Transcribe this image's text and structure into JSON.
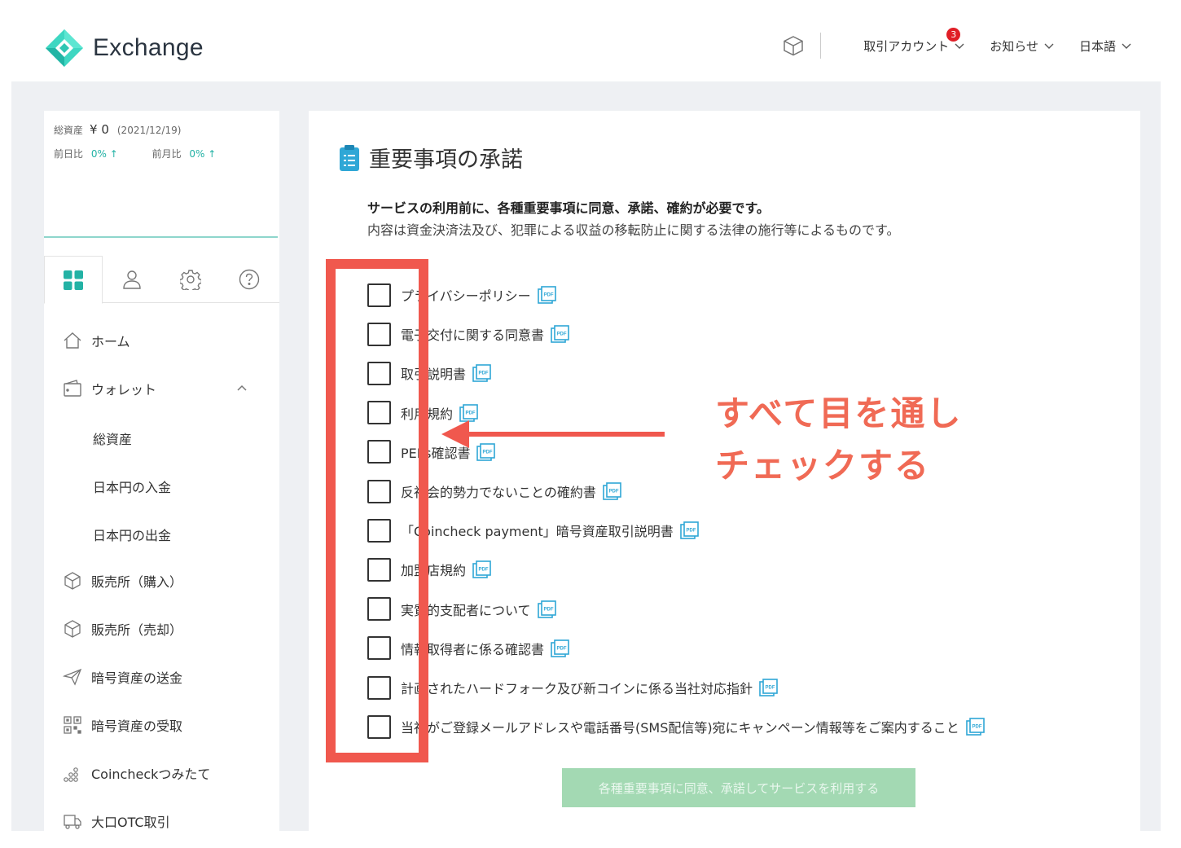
{
  "header": {
    "brand": "Exchange",
    "menu": [
      {
        "label": "取引アカウント",
        "badge": "3"
      },
      {
        "label": "お知らせ"
      },
      {
        "label": "日本語"
      }
    ]
  },
  "sidebar": {
    "assets_label": "総資産",
    "assets_value": "¥ 0",
    "assets_date": "(2021/12/19)",
    "day_label": "前日比",
    "day_value": "0% ↑",
    "month_label": "前月比",
    "month_value": "0% ↑",
    "tabs": [
      "dashboard-icon",
      "user-icon",
      "gear-icon",
      "help-icon"
    ],
    "nav": {
      "home": "ホーム",
      "wallet": "ウォレット",
      "wallet_sub": [
        "総資産",
        "日本円の入金",
        "日本円の出金"
      ],
      "buy": "販売所（購入）",
      "sell": "販売所（売却）",
      "send": "暗号資産の送金",
      "receive": "暗号資産の受取",
      "tsumitate": "Coincheckつみたて",
      "otc": "大口OTC取引"
    }
  },
  "main": {
    "title": "重要事項の承諾",
    "notice_bold": "サービスの利用前に、各種重要事項に同意、承諾、確約が必要です。",
    "notice_sub": "内容は資金決済法及び、犯罪による収益の移転防止に関する法律の施行等によるものです。",
    "items": [
      "プライバシーポリシー",
      "電子交付に関する同意書",
      "取引説明書",
      "利用規約",
      "PEPs確認書",
      "反社会的勢力でないことの確約書",
      "「Coincheck payment」暗号資産取引説明書",
      "加盟店規約",
      "実質的支配者について",
      "情報取得者に係る確認書",
      "計画されたハードフォーク及び新コインに係る当社対応指針",
      "当社がご登録メールアドレスや電話番号(SMS配信等)宛にキャンペーン情報等をご案内すること"
    ],
    "submit": "各種重要事項に同意、承諾してサービスを利用する"
  },
  "annotation": {
    "line1": "すべて目を通し",
    "line2": "チェックする",
    "color": "#f06a55"
  },
  "colors": {
    "brand": "#23b2a5",
    "highlight": "#f0584e",
    "button_disabled": "#a3d9b3"
  }
}
